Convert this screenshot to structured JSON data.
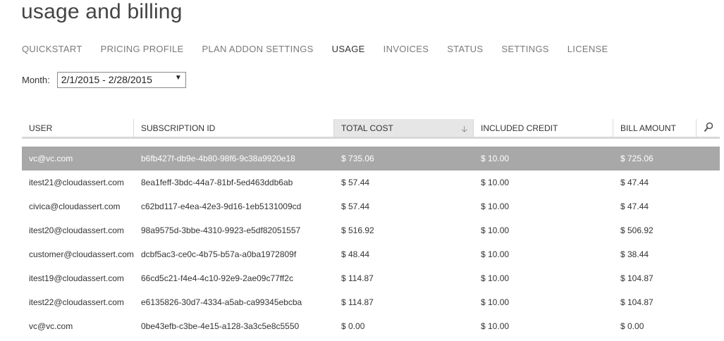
{
  "page": {
    "title": "usage and billing"
  },
  "tabs": [
    {
      "label": "QUICKSTART"
    },
    {
      "label": "PRICING PROFILE"
    },
    {
      "label": "PLAN ADDON SETTINGS"
    },
    {
      "label": "USAGE"
    },
    {
      "label": "INVOICES"
    },
    {
      "label": "STATUS"
    },
    {
      "label": "SETTINGS"
    },
    {
      "label": "LICENSE"
    }
  ],
  "active_tab": "USAGE",
  "month": {
    "label": "Month:",
    "selected": "2/1/2015 - 2/28/2015"
  },
  "table": {
    "columns": [
      "USER",
      "SUBSCRIPTION ID",
      "TOTAL COST",
      "INCLUDED CREDIT",
      "BILL AMOUNT"
    ],
    "sorted_column": "TOTAL COST",
    "rows": [
      {
        "user": "vc@vc.com",
        "subscription_id": "b6fb427f-db9e-4b80-98f6-9c38a9920e18",
        "total_cost": "$ 735.06",
        "included_credit": "$ 10.00",
        "bill_amount": "$ 725.06",
        "selected": true
      },
      {
        "user": "itest21@cloudassert.com",
        "subscription_id": "8ea1feff-3bdc-44a7-81bf-5ed463ddb6ab",
        "total_cost": "$ 57.44",
        "included_credit": "$ 10.00",
        "bill_amount": "$ 47.44"
      },
      {
        "user": "civica@cloudassert.com",
        "subscription_id": "c62bd117-e4ea-42e3-9d16-1eb5131009cd",
        "total_cost": "$ 57.44",
        "included_credit": "$ 10.00",
        "bill_amount": "$ 47.44"
      },
      {
        "user": "itest20@cloudassert.com",
        "subscription_id": "98a9575d-3bbe-4310-9923-e5df82051557",
        "total_cost": "$ 516.92",
        "included_credit": "$ 10.00",
        "bill_amount": "$ 506.92"
      },
      {
        "user": "customer@cloudassert.com",
        "subscription_id": "dcbf5ac3-ce0c-4b75-b57a-a0ba1972809f",
        "total_cost": "$ 48.44",
        "included_credit": "$ 10.00",
        "bill_amount": "$ 38.44"
      },
      {
        "user": "itest19@cloudassert.com",
        "subscription_id": "66cd5c21-f4e4-4c10-92e9-2ae09c77ff2c",
        "total_cost": "$ 114.87",
        "included_credit": "$ 10.00",
        "bill_amount": "$ 104.87"
      },
      {
        "user": "itest22@cloudassert.com",
        "subscription_id": "e6135826-30d7-4334-a5ab-ca99345ebcba",
        "total_cost": "$ 114.87",
        "included_credit": "$ 10.00",
        "bill_amount": "$ 104.87"
      },
      {
        "user": "vc@vc.com",
        "subscription_id": "0be43efb-c3be-4e15-a128-3a3c5e8c5550",
        "total_cost": "$ 0.00",
        "included_credit": "$ 10.00",
        "bill_amount": "$ 0.00"
      }
    ]
  },
  "icons": {
    "sort": "sort-down-arrow-icon",
    "search": "search-icon",
    "dropdown": "dropdown-caret-icon"
  }
}
